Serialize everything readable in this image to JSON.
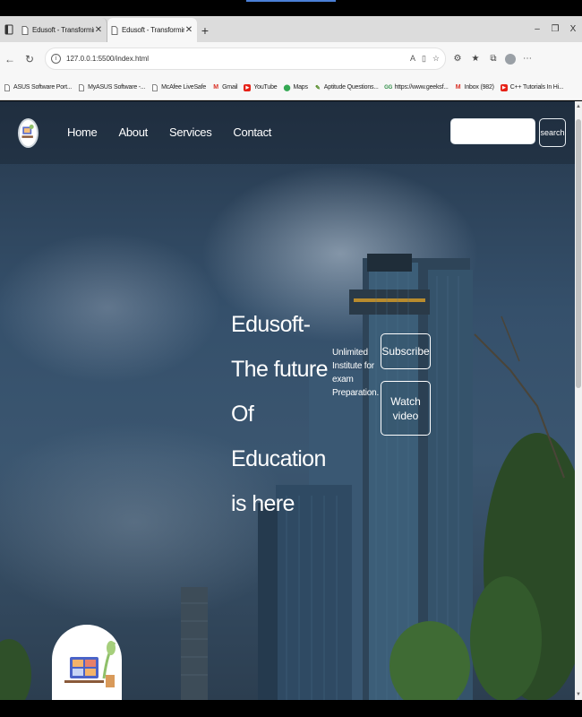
{
  "browser": {
    "tabs": [
      {
        "title": "Edusoft - Transforming Online Ed",
        "active": false
      },
      {
        "title": "Edusoft - Transforming Online Ed",
        "active": true
      }
    ],
    "new_tab_label": "+",
    "window_controls": {
      "minimize": "–",
      "restore": "❐",
      "close": "X"
    },
    "url": "127.0.0.1:5500/index.html",
    "bookmarks": [
      {
        "label": "ASUS Software Port...",
        "icon": "page-icon"
      },
      {
        "label": "MyASUS Software -...",
        "icon": "page-icon"
      },
      {
        "label": "McAfee LiveSafe",
        "icon": "page-icon"
      },
      {
        "label": "Gmail",
        "icon": "gmail-icon",
        "color": "#d93025"
      },
      {
        "label": "YouTube",
        "icon": "youtube-icon",
        "color": "#e62117"
      },
      {
        "label": "Maps",
        "icon": "maps-icon",
        "color": "#34a853"
      },
      {
        "label": "Aptitude Questions...",
        "icon": "leaf-icon",
        "color": "#5a8f2f"
      },
      {
        "label": "https://www.geeksf...",
        "icon": "geeks-icon",
        "color": "#2f8d46"
      },
      {
        "label": "Inbox (982)",
        "icon": "gmail-icon",
        "color": "#d93025"
      },
      {
        "label": "C++ Tutorials In Hi...",
        "icon": "youtube-icon",
        "color": "#e62117"
      }
    ]
  },
  "site": {
    "nav": {
      "links": [
        "Home",
        "About",
        "Services",
        "Contact"
      ],
      "search_button": "search",
      "search_placeholder": ""
    },
    "hero": {
      "title": "Edusoft-The future Of Education is here",
      "subtitle": "Unlimited Institute for exam Preparation.",
      "subscribe_label": "Subscribe",
      "watch_label": "Watch video"
    }
  },
  "colors": {
    "sky": "#35506b",
    "nav_text": "#ffffff",
    "accent_blue": "#4a7fd6"
  }
}
